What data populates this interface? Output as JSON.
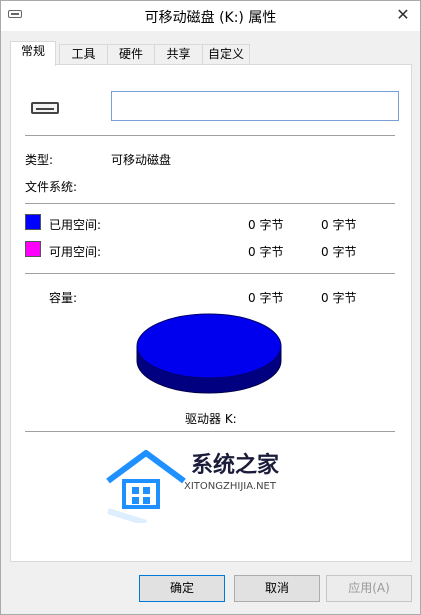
{
  "window": {
    "title": "可移动磁盘 (K:) 属性",
    "close_glyph": "✕"
  },
  "tabs": [
    {
      "label": "常规",
      "active": true
    },
    {
      "label": "工具"
    },
    {
      "label": "硬件"
    },
    {
      "label": "共享"
    },
    {
      "label": "自定义"
    }
  ],
  "general": {
    "drive_name_value": "",
    "type_label": "类型:",
    "type_value": "可移动磁盘",
    "fs_label": "文件系统:",
    "fs_value": "",
    "used_label": "已用空间:",
    "used_bytes": "0 字节",
    "used_size": "0 字节",
    "used_color": "#0000ff",
    "free_label": "可用空间:",
    "free_bytes": "0 字节",
    "free_size": "0 字节",
    "free_color": "#ff00ff",
    "capacity_label": "容量:",
    "capacity_bytes": "0 字节",
    "capacity_size": "0 字节",
    "pie_color": "#0000ee",
    "drive_caption": "驱动器 K:"
  },
  "watermark": {
    "title": "系统之家",
    "subtitle": "XITONGZHIJIA.NET"
  },
  "buttons": {
    "ok": "确定",
    "cancel": "取消",
    "apply": "应用(A)"
  }
}
